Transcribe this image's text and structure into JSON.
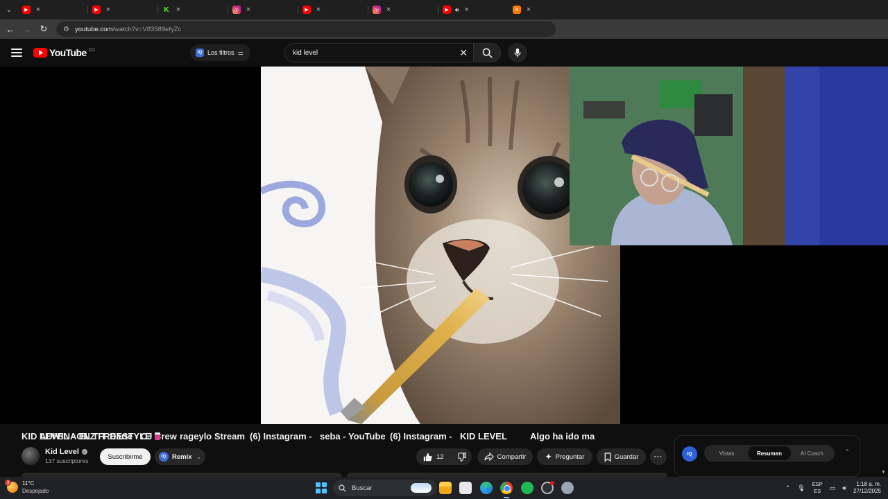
{
  "browser": {
    "tabs": [
      {
        "title": "ADIVINA EL TIT",
        "favicon": "youtube-favicon",
        "active": false
      },
      {
        "title": "Darte - CJ Crew",
        "favicon": "youtube-favicon",
        "active": false
      },
      {
        "title": "rageylo Stream",
        "favicon": "kick-favicon",
        "active": false
      },
      {
        "title": "(6) Instagram -",
        "favicon": "instagram-favicon",
        "active": false
      },
      {
        "title": "seba - YouTube",
        "favicon": "youtube-favicon",
        "active": false
      },
      {
        "title": "(6) Instagram -",
        "favicon": "instagram-favicon",
        "active": false
      },
      {
        "title": "KID LEVEL",
        "favicon": "youtube-favicon",
        "active": true,
        "audio": true
      },
      {
        "title": "Algo ha ido ma",
        "favicon": "blogger-favicon",
        "active": false
      }
    ],
    "url_host": "youtube.com",
    "url_path": "/watch?v=V83589efyZc"
  },
  "youtube": {
    "logo_text": "YouTube",
    "country_code": "CO",
    "filters_label": "Los filtros",
    "search_value": "kid level",
    "video": {
      "title": "KID LEVEL - ONZ FREESTYLE",
      "channel_name": "Kid Level",
      "subscribers": "137 suscriptores",
      "subscribe_label": "Suscribirme",
      "remix_label": "Remix",
      "likes": "12",
      "share_label": "Compartir",
      "ask_label": "Preguntar",
      "save_label": "Guardar",
      "more_label": "···"
    },
    "iq_panel": {
      "logo": "IQ",
      "segments": [
        "Vistas",
        "Resumen",
        "AI Coach"
      ],
      "active_segment": "Resumen"
    }
  },
  "taskbar": {
    "weather_temp": "11°C",
    "weather_condition": "Despejado",
    "weather_badge": "3",
    "search_placeholder": "Buscar",
    "lang_top": "ESP",
    "lang_bottom": "ES",
    "time": "1:18 a. m.",
    "date": "27/12/2025"
  },
  "colors": {
    "youtube_red": "#ff0000",
    "accent_blue": "#3e6fd8",
    "background": "#0f0f0f"
  }
}
